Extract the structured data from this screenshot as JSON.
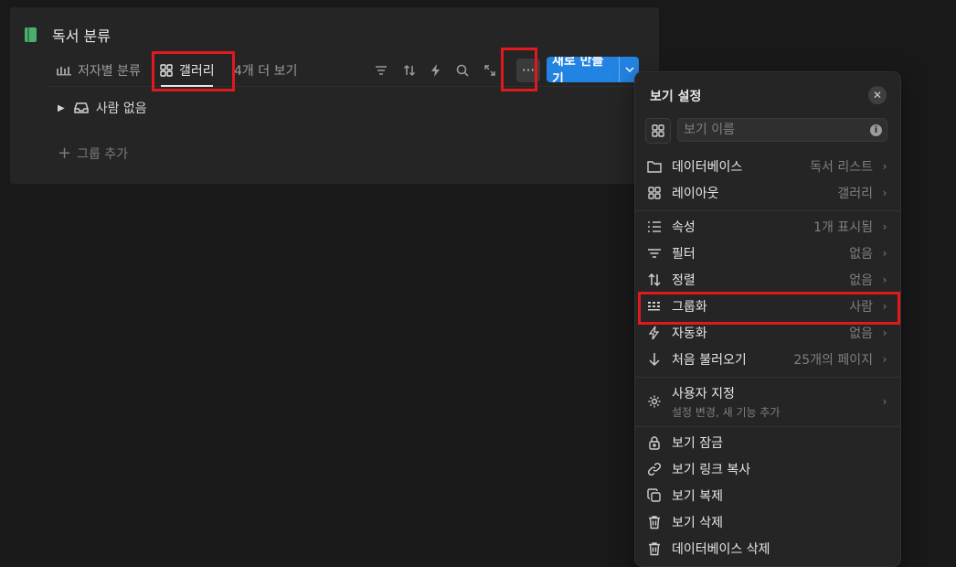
{
  "database": {
    "title": "독서 분류",
    "views": [
      {
        "label": "저자별 분류",
        "icon": "board-group-icon"
      },
      {
        "label": "갤러리",
        "icon": "gallery-grid-icon",
        "active": true
      }
    ],
    "more_views_label": "4개 더 보기",
    "toolbar_icons": [
      "filter-icon",
      "sort-icon",
      "automation-icon",
      "search-icon",
      "expand-icon",
      "more-icon"
    ],
    "new_button_label": "새로 만들기",
    "group_label": "사람 없음",
    "add_group_label": "그룹 추가"
  },
  "menu": {
    "title": "보기 설정",
    "name_placeholder": "보기 이름",
    "info_glyph": "i",
    "items": [
      {
        "key": "database",
        "label": "데이터베이스",
        "value": "독서 리스트",
        "icon": "folder-icon"
      },
      {
        "key": "layout",
        "label": "레이아웃",
        "value": "갤러리",
        "icon": "gallery-grid-icon"
      },
      {
        "key": "properties",
        "label": "속성",
        "value": "1개 표시됨",
        "icon": "list-icon"
      },
      {
        "key": "filter",
        "label": "필터",
        "value": "없음",
        "icon": "filter-icon"
      },
      {
        "key": "sort",
        "label": "정렬",
        "value": "없음",
        "icon": "sort-icon"
      },
      {
        "key": "group",
        "label": "그룹화",
        "value": "사람",
        "icon": "group-icon"
      },
      {
        "key": "automation",
        "label": "자동화",
        "value": "없음",
        "icon": "automation-icon"
      },
      {
        "key": "load",
        "label": "처음 불러오기",
        "value": "25개의 페이지",
        "icon": "arrow-down-icon"
      },
      {
        "key": "customize",
        "label": "사용자 지정",
        "sublabel": "설정 변경, 새 기능 추가",
        "icon": "gear-icon"
      },
      {
        "key": "lock",
        "label": "보기 잠금",
        "icon": "lock-icon"
      },
      {
        "key": "copy_link",
        "label": "보기 링크 복사",
        "icon": "link-icon"
      },
      {
        "key": "duplicate",
        "label": "보기 복제",
        "icon": "duplicate-icon"
      },
      {
        "key": "delete_view",
        "label": "보기 삭제",
        "icon": "trash-icon"
      },
      {
        "key": "delete_db",
        "label": "데이터베이스 삭제",
        "icon": "trash-icon"
      }
    ]
  },
  "colors": {
    "background": "#191919",
    "panel": "#252525",
    "accent": "#2383e2",
    "highlight": "#e0191f",
    "book": "#4caf6e"
  }
}
